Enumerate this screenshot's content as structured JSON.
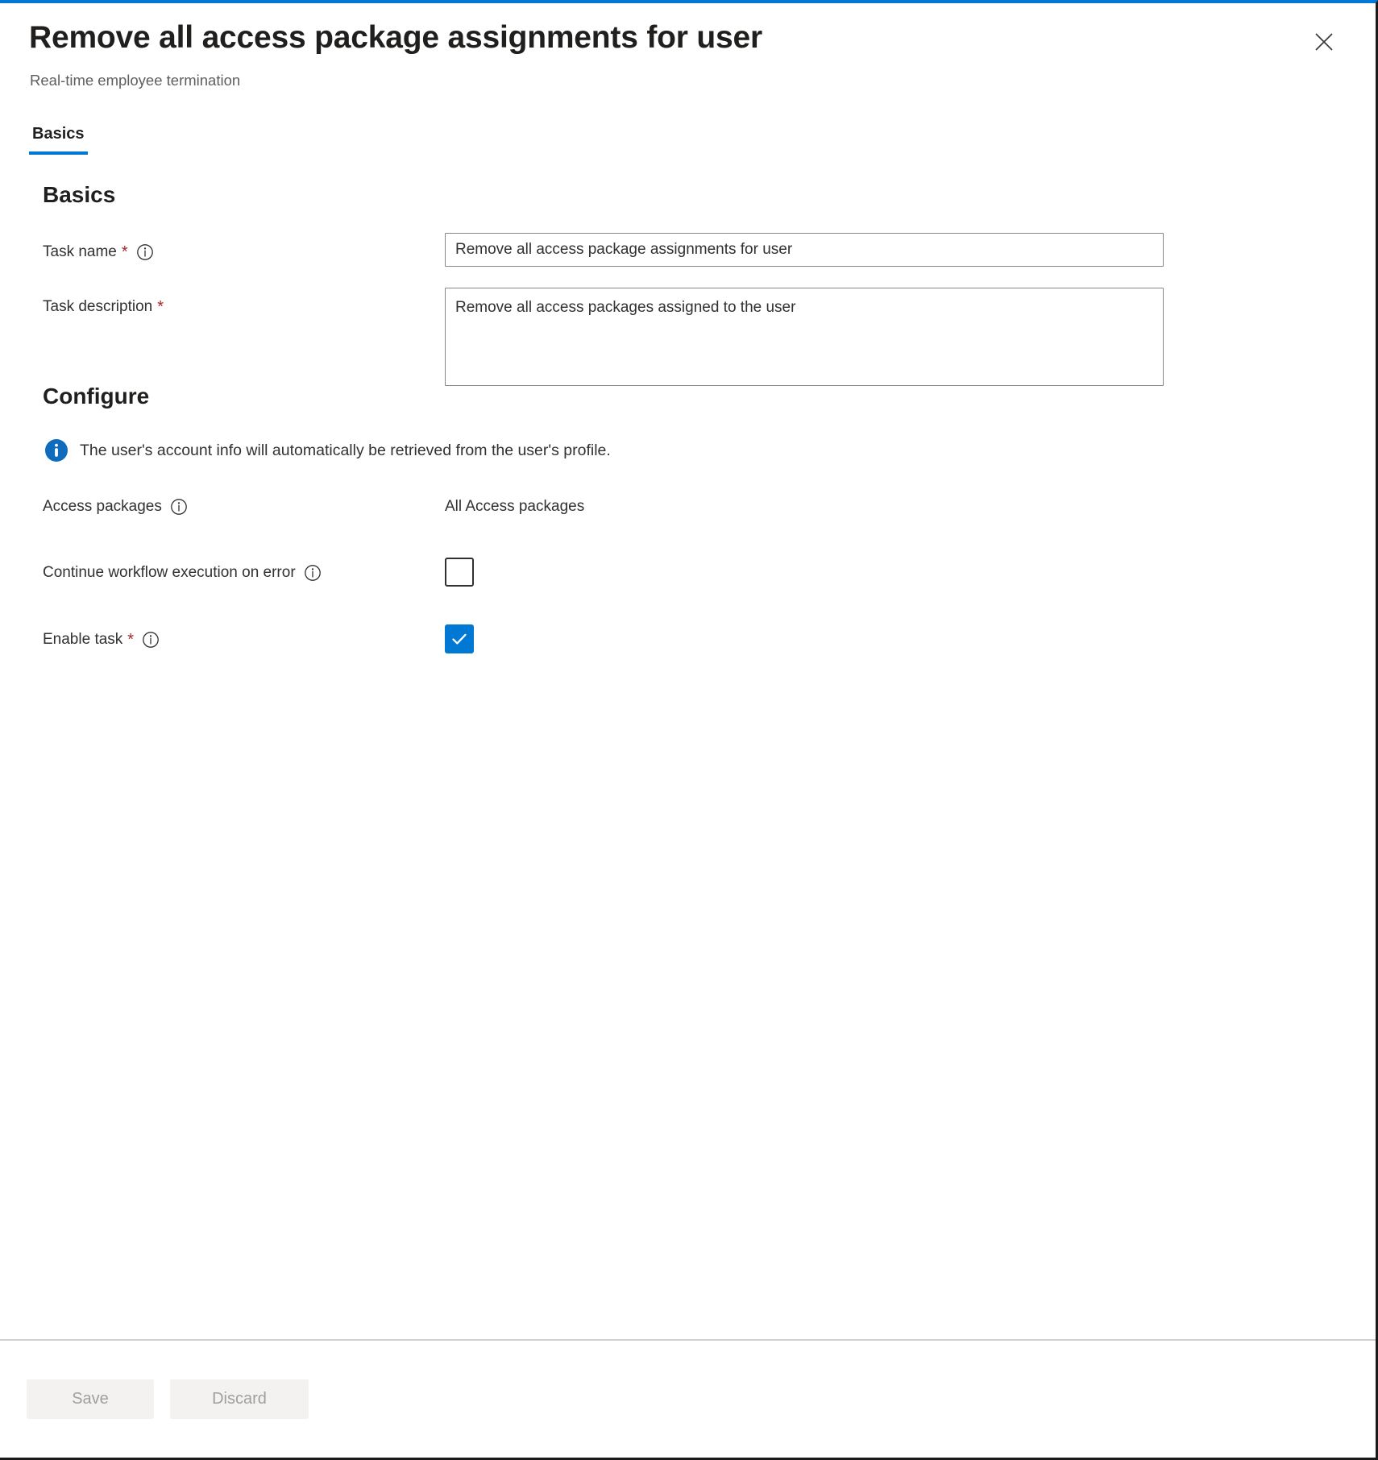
{
  "header": {
    "title": "Remove all access package assignments for user",
    "subtitle": "Real-time employee termination",
    "close_icon": "close-icon",
    "close_label": "Close"
  },
  "tabs": [
    {
      "label": "Basics",
      "selected": true
    }
  ],
  "sections": {
    "basics": {
      "heading": "Basics",
      "fields": [
        {
          "label": "Task name",
          "required": true,
          "info_icon": "info-circle-icon",
          "value": "Remove all access package assignments for user",
          "placeholder": "Task name"
        },
        {
          "label": "Task description",
          "required": true,
          "info_icon": null,
          "value": "Remove all access packages assigned to the user",
          "placeholder": "Task description"
        }
      ]
    },
    "configure": {
      "heading": "Configure",
      "info_banner": {
        "icon": "info-filled-icon",
        "text": "The user's account info will automatically be retrieved from the user's profile."
      },
      "access_packages": {
        "label": "Access packages",
        "info_icon": "info-circle-icon",
        "value": "All Access packages"
      },
      "continue_on_error": {
        "label": "Continue workflow execution on error",
        "info_icon": "info-circle-icon",
        "checked": false
      },
      "enable_task": {
        "label": "Enable task",
        "required": true,
        "info_icon": "info-circle-icon",
        "checked": true
      }
    }
  },
  "footer": {
    "save_label": "Save",
    "discard_label": "Discard"
  },
  "colors": {
    "accent": "#0078d4",
    "required": "#a4262c",
    "text": "#323130",
    "subtle_text": "#605e5c",
    "border": "#8a8886",
    "disabled_bg": "#f3f2f1",
    "disabled_text": "#a19f9d"
  }
}
